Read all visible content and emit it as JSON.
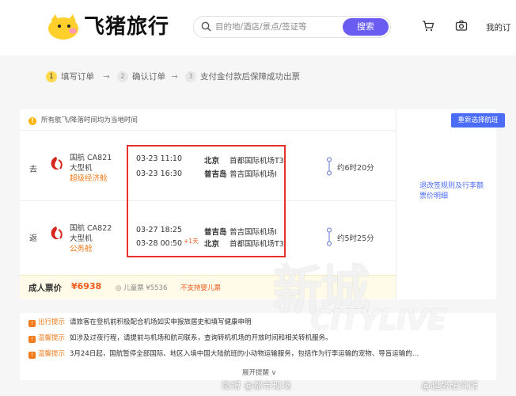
{
  "header": {
    "logo_text": "飞猪旅行",
    "search_placeholder": "目的地/酒店/景点/签证等",
    "search_button": "搜索",
    "my_orders": "我的订"
  },
  "steps": [
    {
      "num": "1",
      "label": "填写订单",
      "active": true
    },
    {
      "num": "2",
      "label": "确认订单",
      "active": false
    },
    {
      "num": "3",
      "label": "支付金付款后保障成功出票",
      "active": false
    }
  ],
  "step_arrow": "→",
  "notice": "所有航飞/降落时间均为当地时间",
  "reselect_button": "重新选择航班",
  "flights": [
    {
      "direction": "去",
      "flight_no": "国航 CA821",
      "plane": "大型机",
      "cabin": "超级经济舱",
      "dep_time": "03-23 11:10",
      "arr_time": "03-23 16:30",
      "arr_plus": "",
      "dep_city": "北京",
      "dep_airport": "首都国际机场T3",
      "arr_city": "普吉岛",
      "arr_airport": "普吉国际机场I",
      "duration": "约6时20分"
    },
    {
      "direction": "返",
      "flight_no": "国航 CA822",
      "plane": "大型机",
      "cabin": "公务舱",
      "dep_time": "03-27 18:25",
      "arr_time": "03-28 00:50",
      "arr_plus": "+1天",
      "dep_city": "普吉岛",
      "dep_airport": "普吉国际机场I",
      "arr_city": "北京",
      "arr_airport": "首都国际机场T3",
      "duration": "约5时25分"
    }
  ],
  "side_links": [
    "退改签规则及行李额",
    "票价明细"
  ],
  "price": {
    "adult_label": "成人票价",
    "adult_value": "¥6938",
    "child": "儿童票 ¥5536",
    "no_child": "不支持婴儿票"
  },
  "tips": [
    {
      "tag": "出行提示",
      "text": "请旅客在登机前积极配合机场如实申报旅居史和填写健康申明"
    },
    {
      "tag": "温馨提示",
      "text": "如涉及过夜行程，请提前与机场和航司联系，查询转机机场的开放时间和相关转机服务。"
    },
    {
      "tag": "温馨提示",
      "text": "3月24日起，国航暂停全部国际、地区入境中国大陆航班的小动物运输服务，包括作为行李运输的宠物、导盲运输的…"
    }
  ],
  "expand_label": "展开提醒 ∨",
  "watermarks": {
    "big": "新城",
    "sub": "CITYLIVE",
    "left": "微博 @都市现场",
    "right": "@趋势研究所"
  },
  "colors": {
    "accent": "#6a5cf0",
    "link": "#4a6cf7",
    "price": "#f05a1c",
    "highlight_box": "#e8312d",
    "step_active": "#ffd84d"
  }
}
